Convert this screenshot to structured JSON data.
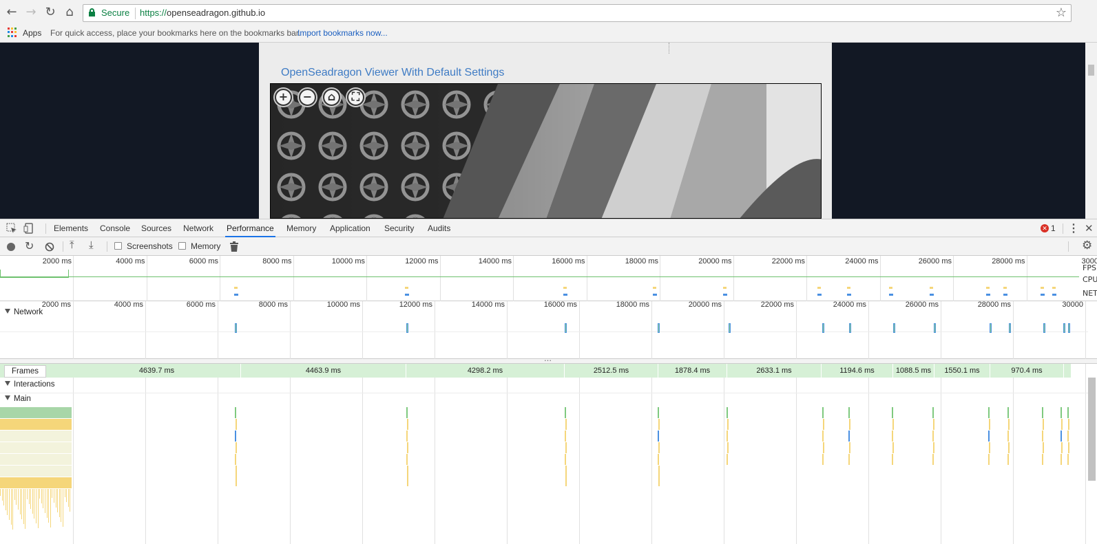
{
  "browser": {
    "nav": {
      "back": "←",
      "forward": "→",
      "reload": "↻",
      "home": "⌂"
    },
    "omnibox": {
      "security_label": "Secure",
      "url_scheme": "https://",
      "url_host": "openseadragon.github.io",
      "icons": [
        "lock-icon",
        "star-icon"
      ]
    },
    "bookmarks_bar": {
      "apps_label": "Apps",
      "hint_text": "For quick access, place your bookmarks here on the bookmarks bar.",
      "import_link": "Import bookmarks now..."
    }
  },
  "page": {
    "viewer_title": "OpenSeadragon Viewer With Default Settings",
    "viewer_controls": [
      {
        "name": "zoom-in",
        "glyph": "+"
      },
      {
        "name": "zoom-out",
        "glyph": "−"
      },
      {
        "name": "home",
        "glyph": "⌂"
      },
      {
        "name": "fullscreen",
        "glyph": "⛶"
      }
    ]
  },
  "devtools": {
    "tabs": [
      "Elements",
      "Console",
      "Sources",
      "Network",
      "Performance",
      "Memory",
      "Application",
      "Security",
      "Audits"
    ],
    "active_tab": "Performance",
    "error_count": "1",
    "close": "✕",
    "perf_toolbar": {
      "screenshots_label": "Screenshots",
      "memory_label": "Memory"
    },
    "overview": {
      "ticks": [
        "2000 ms",
        "4000 ms",
        "6000 ms",
        "8000 ms",
        "10000 ms",
        "12000 ms",
        "14000 ms",
        "16000 ms",
        "18000 ms",
        "20000 ms",
        "22000 ms",
        "24000 ms",
        "26000 ms",
        "28000 ms",
        "3000"
      ],
      "labels": [
        "FPS",
        "CPU",
        "NET"
      ]
    },
    "timeline_ticks": [
      "2000 ms",
      "4000 ms",
      "6000 ms",
      "8000 ms",
      "10000 ms",
      "12000 ms",
      "14000 ms",
      "16000 ms",
      "18000 ms",
      "20000 ms",
      "22000 ms",
      "24000 ms",
      "26000 ms",
      "28000 ms",
      "30000"
    ],
    "sections": {
      "network": "Network",
      "frames": "Frames",
      "interactions": "Interactions",
      "main": "Main"
    },
    "frames": [
      "4639.7 ms",
      "4463.9 ms",
      "4298.2 ms",
      "2512.5 ms",
      "1878.4 ms",
      "2633.1 ms",
      "1194.6 ms",
      "1088.5 ms",
      "1550.1 ms",
      "970.4 ms"
    ],
    "colors": {
      "accent": "#1a73e8",
      "secure_green": "#0b8043",
      "frame_green": "#d6f0d6",
      "scripting_yellow": "#f5d67a",
      "rendering_purple": "#9b7fd9",
      "painting_green": "#7fc97f",
      "network_blue": "#4a90e2"
    }
  }
}
